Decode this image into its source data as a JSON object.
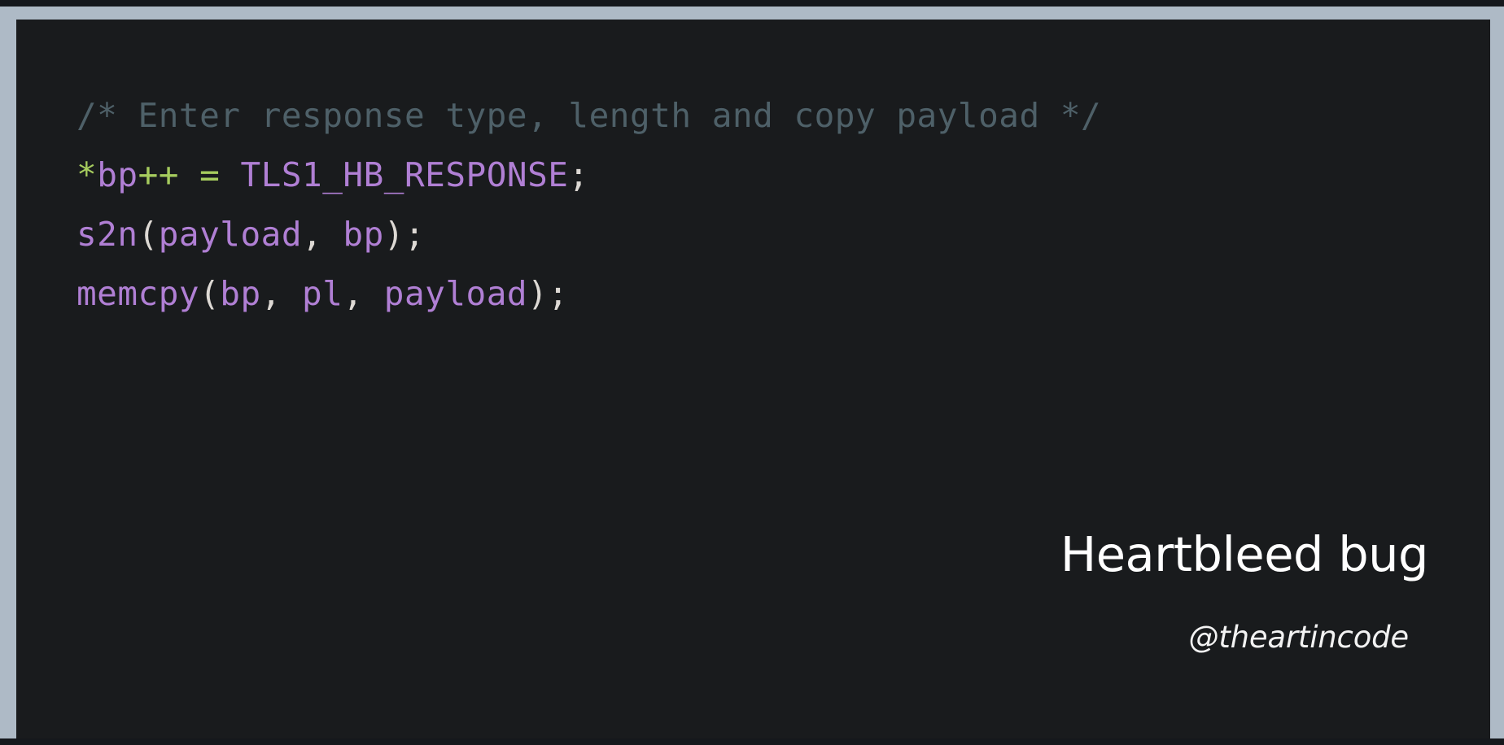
{
  "theme": {
    "frame_color": "#aebac6",
    "outer_edge_color": "#15181c",
    "card_background": "#191b1d",
    "comment_color": "#4e6068",
    "operator_color": "#a6cc5e",
    "identifier_color": "#b07fd4",
    "punctuation_color": "#ddd9d4",
    "caption_color": "#ffffff"
  },
  "code": {
    "language": "c",
    "plain_text": "/* Enter response type, length and copy payload */\n*bp++ = TLS1_HB_RESPONSE;\ns2n(payload, bp);\nmemcpy(bp, pl, payload);",
    "lines": [
      {
        "index": 1,
        "text": "/* Enter response type, length and copy payload */",
        "tokens": [
          {
            "t": "/* Enter response type, length and copy payload */",
            "c": "comment"
          }
        ]
      },
      {
        "index": 2,
        "text": "*bp++ = TLS1_HB_RESPONSE;",
        "tokens": [
          {
            "t": "*",
            "c": "op"
          },
          {
            "t": "bp",
            "c": "ident"
          },
          {
            "t": "++",
            "c": "op"
          },
          {
            "t": " ",
            "c": "plain"
          },
          {
            "t": "=",
            "c": "op"
          },
          {
            "t": " ",
            "c": "plain"
          },
          {
            "t": "TLS1_HB_RESPONSE",
            "c": "ident"
          },
          {
            "t": ";",
            "c": "punct"
          }
        ]
      },
      {
        "index": 3,
        "text": "s2n(payload, bp);",
        "tokens": [
          {
            "t": "s2n",
            "c": "ident"
          },
          {
            "t": "(",
            "c": "punct"
          },
          {
            "t": "payload",
            "c": "ident"
          },
          {
            "t": ",",
            "c": "punct"
          },
          {
            "t": " ",
            "c": "plain"
          },
          {
            "t": "bp",
            "c": "ident"
          },
          {
            "t": ")",
            "c": "punct"
          },
          {
            "t": ";",
            "c": "punct"
          }
        ]
      },
      {
        "index": 4,
        "text": "memcpy(bp, pl, payload);",
        "tokens": [
          {
            "t": "memcpy",
            "c": "ident"
          },
          {
            "t": "(",
            "c": "punct"
          },
          {
            "t": "bp",
            "c": "ident"
          },
          {
            "t": ",",
            "c": "punct"
          },
          {
            "t": " ",
            "c": "plain"
          },
          {
            "t": "pl",
            "c": "ident"
          },
          {
            "t": ",",
            "c": "punct"
          },
          {
            "t": " ",
            "c": "plain"
          },
          {
            "t": "payload",
            "c": "ident"
          },
          {
            "t": ")",
            "c": "punct"
          },
          {
            "t": ";",
            "c": "punct"
          }
        ]
      }
    ]
  },
  "caption": {
    "title": "Heartbleed bug",
    "handle": "@theartincode"
  }
}
